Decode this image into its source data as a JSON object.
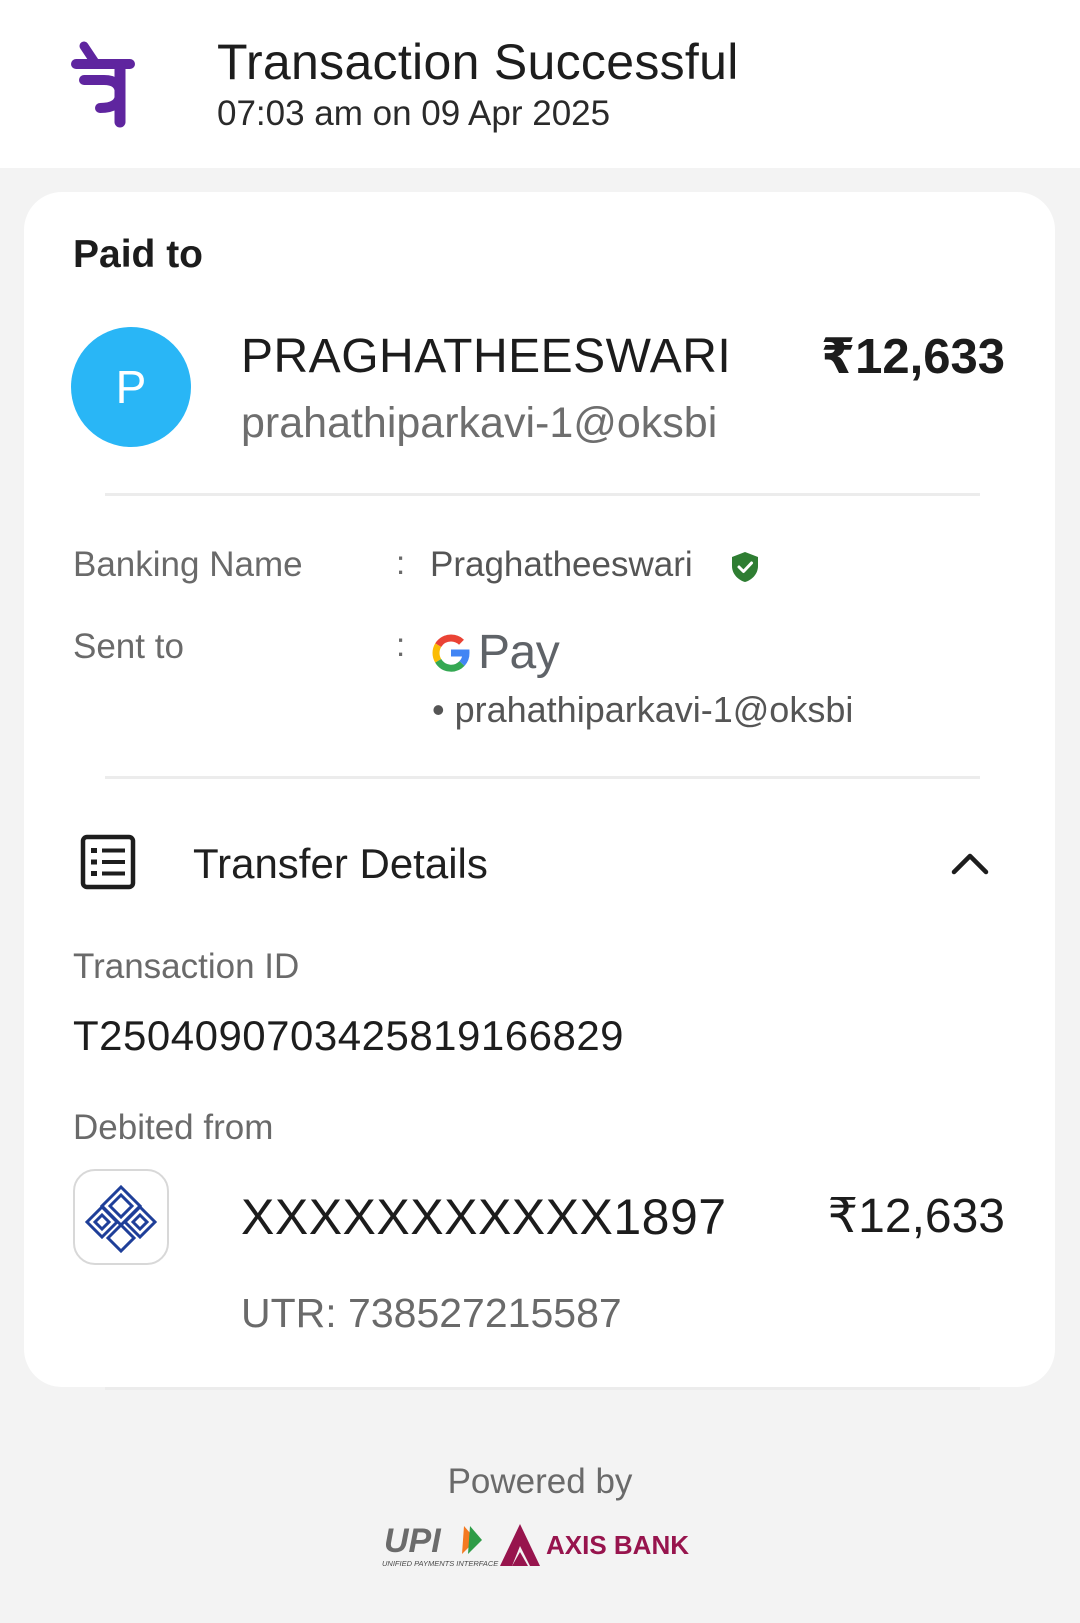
{
  "header": {
    "title": "Transaction Successful",
    "timestamp": "07:03 am on 09 Apr 2025",
    "app_logo": "phonepe-logo",
    "brand_color": "#5f259f"
  },
  "paid_to": {
    "section_label": "Paid to",
    "avatar_initial": "P",
    "avatar_color": "#29b6f6",
    "name": "PRAGHATHEESWARI",
    "upi_id": "prahathiparkavi-1@oksbi",
    "amount": "₹12,633"
  },
  "details": {
    "banking_name_label": "Banking Name",
    "banking_name_value": "Praghatheeswari",
    "verified_icon": "verified-shield-icon",
    "verified_color": "#2e7d32",
    "sent_to_label": "Sent to",
    "sent_to_app": "Pay",
    "sent_to_upi": "• prahathiparkavi-1@oksbi",
    "colon": ":"
  },
  "transfer_details": {
    "title": "Transfer Details",
    "icon": "receipt-list-icon",
    "toggle_icon": "chevron-up-icon",
    "transaction_id_label": "Transaction ID",
    "transaction_id": "T2504090703425819166829",
    "debited_from_label": "Debited from",
    "bank_icon": "bank-logo-icon",
    "account_number": "XXXXXXXXXXX1897",
    "account_amount": "₹12,633",
    "utr": "UTR: 738527215587"
  },
  "footer": {
    "powered_by": "Powered by",
    "upi_logo": "UPI",
    "upi_subtitle": "UNIFIED PAYMENTS INTERFACE",
    "bank_partner": "AXIS BANK",
    "axis_color": "#97144d"
  }
}
